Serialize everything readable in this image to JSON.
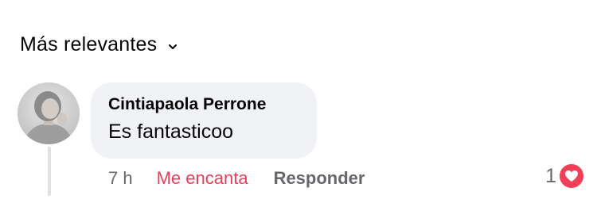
{
  "sort": {
    "label": "Más relevantes",
    "icon": "chevron-down-icon"
  },
  "comment": {
    "author": "Cintiapaola Perrone",
    "text": "Es fantasticoo",
    "time": "7 h",
    "love_label": "Me encanta",
    "reply_label": "Responder",
    "reaction_count": "1",
    "reaction_icon": "heart-icon",
    "colors": {
      "love": "#e4405c",
      "heart_badge": "#f33e58",
      "bubble": "#f0f2f5",
      "secondary_text": "#65676b"
    }
  }
}
